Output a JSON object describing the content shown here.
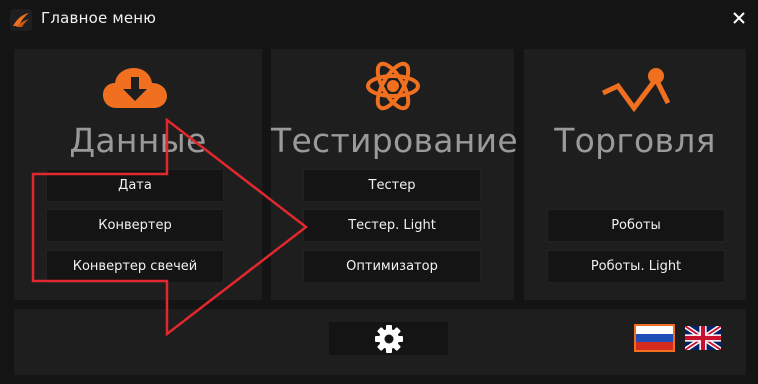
{
  "window": {
    "title": "Главное меню",
    "icon": "app-logo-icon",
    "close_icon": "close-icon"
  },
  "colors": {
    "background": "#141414",
    "panel": "#1e1e1e",
    "accent": "#f07020",
    "section_title": "#9a9a9a",
    "annotation_arrow": "#e0282e"
  },
  "sections": {
    "data": {
      "icon": "cloud-download-icon",
      "title": "Данные",
      "buttons": [
        "Дата",
        "Конвертер",
        "Конвертер свечей"
      ]
    },
    "testing": {
      "icon": "atom-icon",
      "title": "Тестирование",
      "buttons": [
        "Тестер",
        "Тестер. Light",
        "Оптимизатор"
      ]
    },
    "trading": {
      "icon": "chart-line-icon",
      "title": "Торговля",
      "buttons": [
        "Роботы",
        "Роботы. Light"
      ]
    }
  },
  "footer": {
    "settings_icon": "gear-icon",
    "languages": [
      {
        "icon": "russia-flag-icon",
        "selected": true
      },
      {
        "icon": "uk-flag-icon",
        "selected": false
      }
    ]
  }
}
